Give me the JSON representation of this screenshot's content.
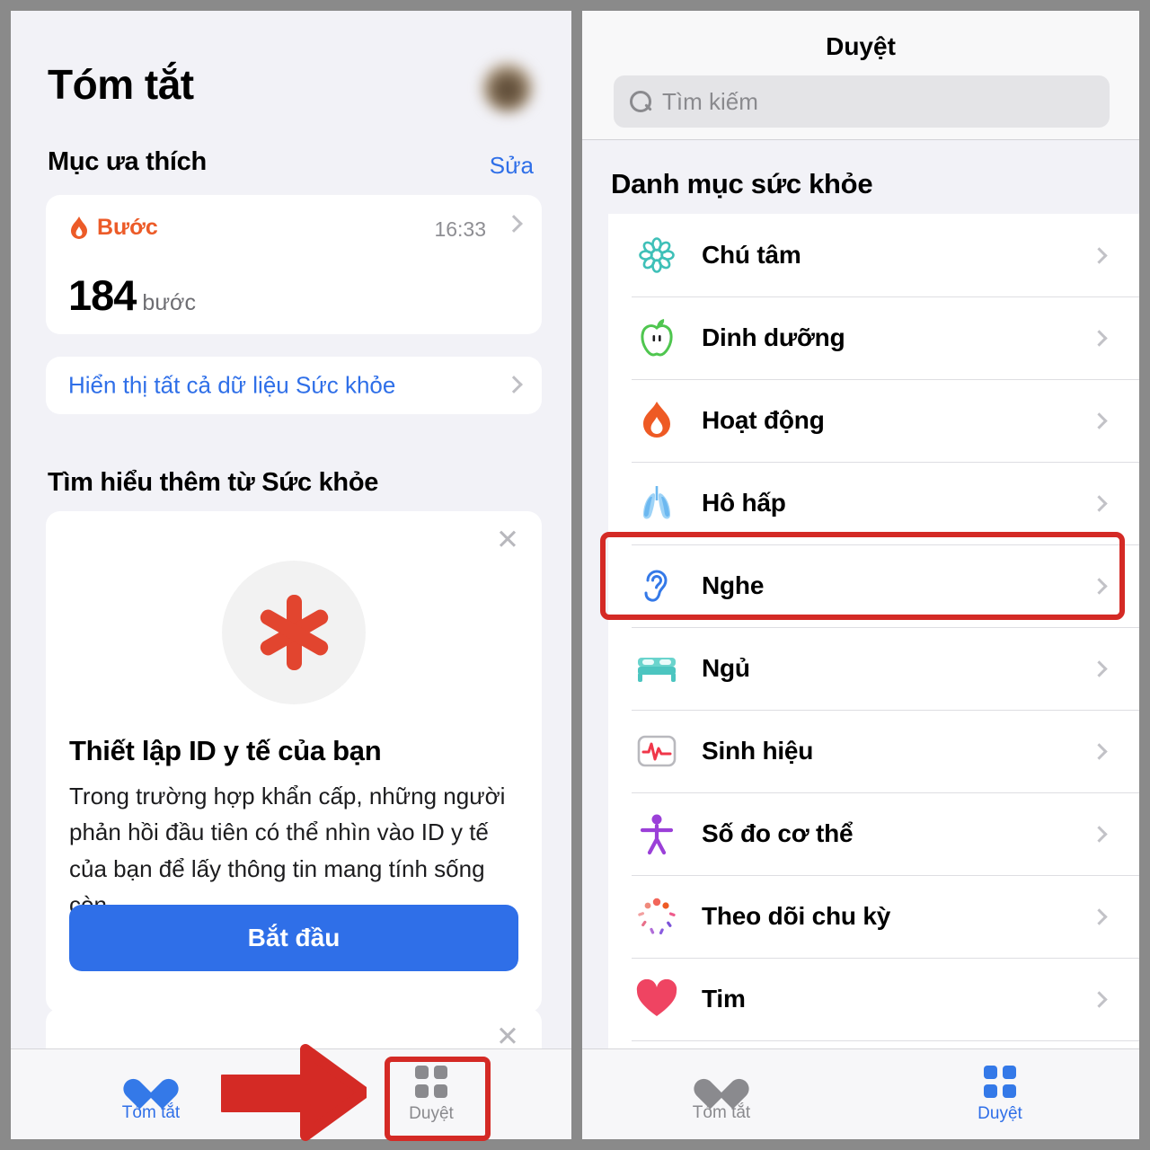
{
  "colors": {
    "accent_blue": "#2f6fe8",
    "orange": "#ec5b28",
    "red_highlight": "#d42a25",
    "panel_bg": "#f2f2f7",
    "medical_red": "#e2452f"
  },
  "left_screen": {
    "title": "Tóm tắt",
    "favorites": {
      "heading": "Mục ưa thích",
      "edit_link": "Sửa",
      "metric_card": {
        "name": "Bước",
        "time": "16:33",
        "value": "184",
        "unit": "bước"
      },
      "show_all_link": "Hiển thị tất cả dữ liệu Sức khỏe"
    },
    "learn_more": {
      "heading": "Tìm hiểu thêm từ Sức khỏe",
      "card": {
        "title": "Thiết lập ID y tế của bạn",
        "body": "Trong trường hợp khẩn cấp, những người phản hồi đầu tiên có thể nhìn vào ID y tế của bạn để lấy thông tin mang tính sống còn.",
        "button": "Bắt đầu"
      }
    },
    "tabs": [
      {
        "label": "Tóm tắt",
        "icon": "heart-icon",
        "active": true
      },
      {
        "label": "Duyệt",
        "icon": "grid-icon",
        "active": false
      }
    ]
  },
  "right_screen": {
    "title": "Duyệt",
    "search": {
      "placeholder": "Tìm kiếm",
      "value": ""
    },
    "categories_heading": "Danh mục sức khỏe",
    "categories": [
      {
        "label": "Chú tâm",
        "icon": "mindfulness-icon",
        "color": "#3fc0b8"
      },
      {
        "label": "Dinh dưỡng",
        "icon": "apple-icon",
        "color": "#4fc64f"
      },
      {
        "label": "Hoạt động",
        "icon": "flame-icon",
        "color": "#ee5a24"
      },
      {
        "label": "Hô hấp",
        "icon": "lungs-icon",
        "color": "#6cb8f0"
      },
      {
        "label": "Nghe",
        "icon": "ear-icon",
        "color": "#3479e8"
      },
      {
        "label": "Ngủ",
        "icon": "bed-icon",
        "color": "#4cc5c0"
      },
      {
        "label": "Sinh hiệu",
        "icon": "vitals-icon",
        "color": "#f0374a"
      },
      {
        "label": "Số đo cơ thể",
        "icon": "body-icon",
        "color": "#9b40d8"
      },
      {
        "label": "Theo dõi chu kỳ",
        "icon": "cycle-icon",
        "color": "#ee5a5a"
      },
      {
        "label": "Tim",
        "icon": "heart-icon",
        "color": "#ef4462"
      },
      {
        "label": "",
        "icon": "mobility-icon",
        "color": "#4b42c8"
      }
    ],
    "tabs": [
      {
        "label": "Tóm tắt",
        "icon": "heart-icon",
        "active": false
      },
      {
        "label": "Duyệt",
        "icon": "grid-icon",
        "active": true
      }
    ]
  },
  "annotations": {
    "arrow": "red-right-arrow",
    "highlight_nghe": "Nghe",
    "highlight_duyet": "Duyệt"
  }
}
